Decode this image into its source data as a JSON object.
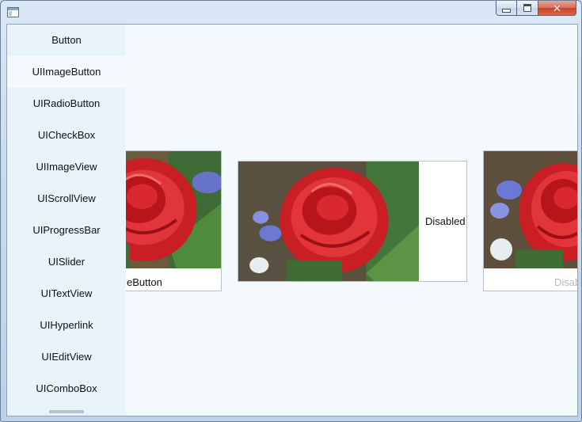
{
  "window": {
    "controls": {
      "minimize_icon": "minimize-icon",
      "maximize_icon": "maximize-icon",
      "close_icon": "close-icon",
      "close_glyph": "✕"
    }
  },
  "sidebar": {
    "items": [
      {
        "label": "Button",
        "selected": false
      },
      {
        "label": "UIImageButton",
        "selected": true
      },
      {
        "label": "UIRadioButton",
        "selected": false
      },
      {
        "label": "UICheckBox",
        "selected": false
      },
      {
        "label": "UIImageView",
        "selected": false
      },
      {
        "label": "UIScrollView",
        "selected": false
      },
      {
        "label": "UIProgressBar",
        "selected": false
      },
      {
        "label": "UISlider",
        "selected": false
      },
      {
        "label": "UITextView",
        "selected": false
      },
      {
        "label": "UIHyperlink",
        "selected": false
      },
      {
        "label": "UIEditView",
        "selected": false
      },
      {
        "label": "UIComboBox",
        "selected": false
      }
    ]
  },
  "content": {
    "cards": [
      {
        "label": "eButton",
        "disabled": false
      },
      {
        "label": "Disabled",
        "disabled": false
      },
      {
        "label": "Disab",
        "disabled": true
      }
    ]
  },
  "colors": {
    "sidebar_bg": "#e9f3fc",
    "content_bg": "#f3f9fd",
    "selected_item_bg": "#f6fafe",
    "disabled_text": "#bcbcbc",
    "close_button": "#c7452a"
  }
}
